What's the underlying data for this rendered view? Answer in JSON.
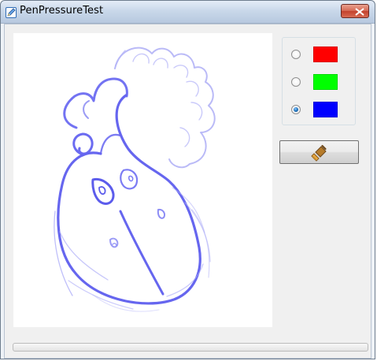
{
  "window": {
    "title": "PenPressureTest"
  },
  "colors": [
    {
      "name": "red",
      "hex": "#ff0000",
      "selected": false
    },
    {
      "name": "green",
      "hex": "#00ff00",
      "selected": false
    },
    {
      "name": "blue",
      "hex": "#0000ff",
      "selected": true
    }
  ],
  "icons": {
    "app": "pen-app-icon",
    "close": "close-icon",
    "clear": "broom-icon"
  },
  "pressure": {
    "value": 0
  },
  "drawing": {
    "stroke_color": "#5a5af0"
  }
}
